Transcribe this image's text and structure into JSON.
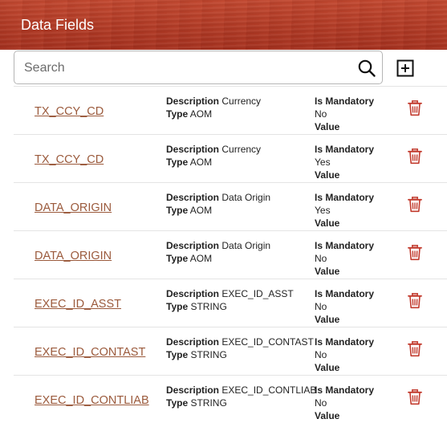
{
  "header": {
    "title": "Data Fields"
  },
  "search": {
    "placeholder": "Search",
    "value": ""
  },
  "icons": {
    "search": "search-icon",
    "add": "add-square-icon",
    "delete": "trash-icon"
  },
  "colors": {
    "header_bg": "#b33c26",
    "link": "#9b5a3c",
    "delete_icon": "#c23b2e"
  },
  "labels": {
    "description": "Description",
    "type": "Type",
    "is_mandatory": "Is Mandatory",
    "value": "Value"
  },
  "fields": [
    {
      "name": "TX_CCY_CD",
      "description": "Currency",
      "type": "AOM",
      "mandatory": "No",
      "value": ""
    },
    {
      "name": "TX_CCY_CD",
      "description": "Currency",
      "type": "AOM",
      "mandatory": "Yes",
      "value": ""
    },
    {
      "name": "DATA_ORIGIN",
      "description": "Data Origin",
      "type": "AOM",
      "mandatory": "Yes",
      "value": ""
    },
    {
      "name": "DATA_ORIGIN",
      "description": "Data Origin",
      "type": "AOM",
      "mandatory": "No",
      "value": ""
    },
    {
      "name": "EXEC_ID_ASST",
      "description": "EXEC_ID_ASST",
      "type": "STRING",
      "mandatory": "No",
      "value": ""
    },
    {
      "name": "EXEC_ID_CONTAST",
      "description": "EXEC_ID_CONTAST",
      "type": "STRING",
      "mandatory": "No",
      "value": ""
    },
    {
      "name": "EXEC_ID_CONTLIAB",
      "description": "EXEC_ID_CONTLIAB",
      "type": "STRING",
      "mandatory": "No",
      "value": ""
    }
  ]
}
